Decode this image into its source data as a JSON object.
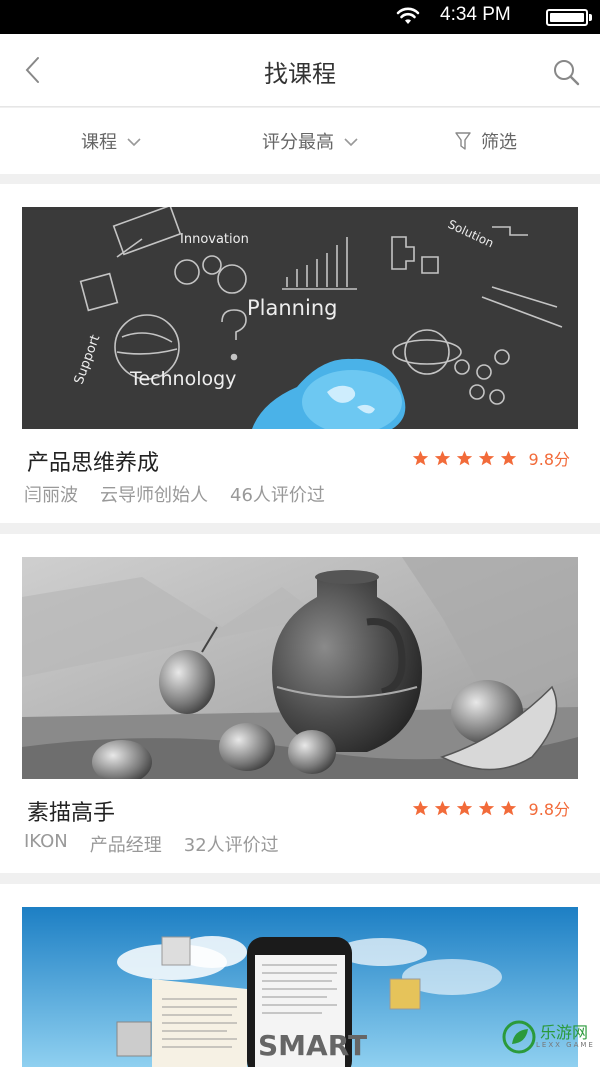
{
  "status_bar": {
    "time": "4:34 PM"
  },
  "header": {
    "title": "找课程"
  },
  "filters": [
    {
      "label": "课程"
    },
    {
      "label": "评分最高"
    },
    {
      "label": "筛选"
    }
  ],
  "courses": [
    {
      "title": "产品思维养成",
      "teacher": "闫丽波",
      "role": "云导师创始人",
      "reviews": "46人评价过",
      "score": "9.8分",
      "stars": 5,
      "image_words": [
        "Innovation",
        "Planning",
        "Technology",
        "Support",
        "Solution"
      ]
    },
    {
      "title": "素描高手",
      "teacher": "IKON",
      "role": "产品经理",
      "reviews": "32人评价过",
      "score": "9.8分",
      "stars": 5
    },
    {
      "image_words": [
        "SMART"
      ]
    }
  ],
  "watermark": {
    "text": "乐游网",
    "sub": "LEXX GAME"
  },
  "colors": {
    "accent": "#f26b3a",
    "text_dark": "#222222",
    "text_muted": "#999999"
  }
}
